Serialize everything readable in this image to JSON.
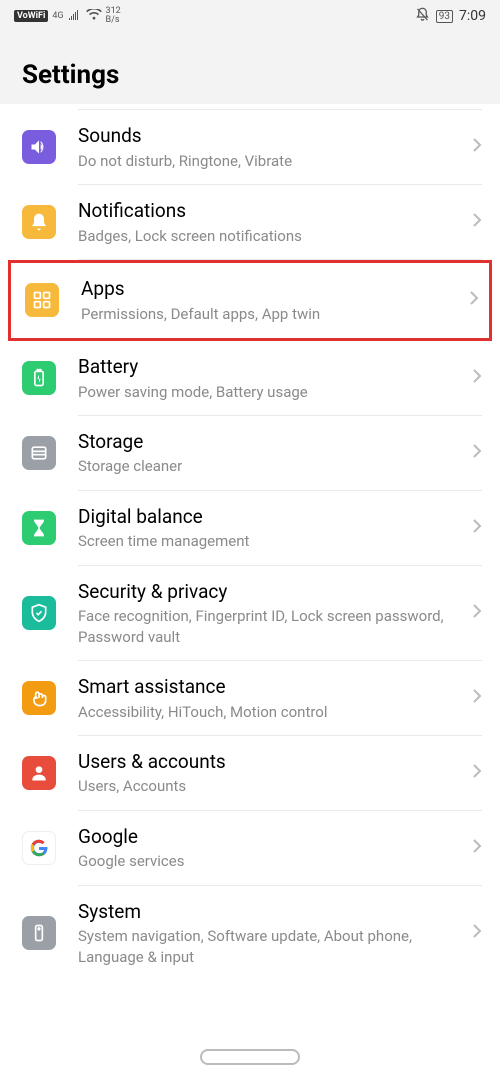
{
  "status": {
    "vowifi": "VoWiFi",
    "network": "4G",
    "speed_value": "312",
    "speed_unit": "B/s",
    "battery": "93",
    "time": "7:09"
  },
  "header": {
    "title": "Settings"
  },
  "items": [
    {
      "title": "Sounds",
      "sub": "Do not disturb, Ringtone, Vibrate",
      "icon": "sounds",
      "color": "#7a5cde"
    },
    {
      "title": "Notifications",
      "sub": "Badges, Lock screen notifications",
      "icon": "notifications",
      "color": "#f6b93b"
    },
    {
      "title": "Apps",
      "sub": "Permissions, Default apps, App twin",
      "icon": "apps",
      "color": "#f6b93b",
      "highlighted": true
    },
    {
      "title": "Battery",
      "sub": "Power saving mode, Battery usage",
      "icon": "battery",
      "color": "#2ecc71"
    },
    {
      "title": "Storage",
      "sub": "Storage cleaner",
      "icon": "storage",
      "color": "#9aa0a6"
    },
    {
      "title": "Digital balance",
      "sub": "Screen time management",
      "icon": "digital-balance",
      "color": "#2ecc71"
    },
    {
      "title": "Security & privacy",
      "sub": "Face recognition, Fingerprint ID, Lock screen password, Password vault",
      "icon": "security",
      "color": "#1abc9c"
    },
    {
      "title": "Smart assistance",
      "sub": "Accessibility, HiTouch, Motion control",
      "icon": "smart-assistance",
      "color": "#f39c12"
    },
    {
      "title": "Users & accounts",
      "sub": "Users, Accounts",
      "icon": "users",
      "color": "#e74c3c"
    },
    {
      "title": "Google",
      "sub": "Google services",
      "icon": "google",
      "color": "#ffffff"
    },
    {
      "title": "System",
      "sub": "System navigation, Software update, About phone, Language & input",
      "icon": "system",
      "color": "#9aa0a6"
    }
  ]
}
